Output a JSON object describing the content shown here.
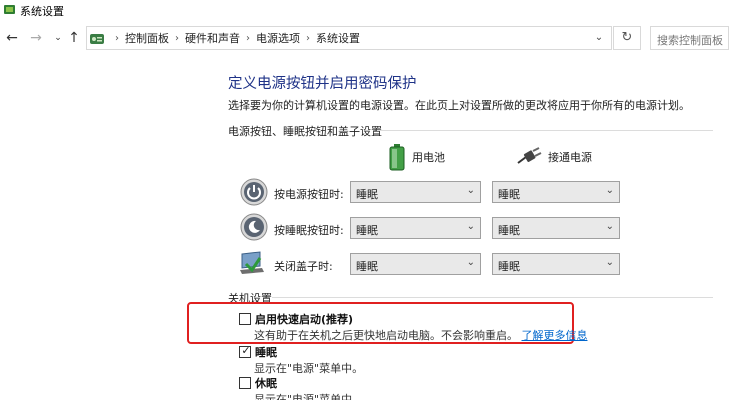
{
  "window": {
    "title": "系统设置"
  },
  "nav": {
    "breadcrumbs": [
      "控制面板",
      "硬件和声音",
      "电源选项",
      "系统设置"
    ],
    "search_placeholder": "搜索控制面板"
  },
  "page": {
    "heading": "定义电源按钮并启用密码保护",
    "subtitle": "选择要为你的计算机设置的电源设置。在此页上对设置所做的更改将应用于你所有的电源计划。"
  },
  "buttons_section": {
    "label": "电源按钮、睡眠按钮和盖子设置",
    "columns": [
      {
        "label": "用电池",
        "icon": "battery-icon"
      },
      {
        "label": "接通电源",
        "icon": "plug-icon"
      }
    ],
    "rows": [
      {
        "label": "按电源按钮时:",
        "icon": "power-button-icon",
        "battery": "睡眠",
        "plugged": "睡眠"
      },
      {
        "label": "按睡眠按钮时:",
        "icon": "sleep-button-icon",
        "battery": "睡眠",
        "plugged": "睡眠"
      },
      {
        "label": "关闭盖子时:",
        "icon": "laptop-lid-icon",
        "battery": "睡眠",
        "plugged": "睡眠"
      }
    ]
  },
  "shutdown_section": {
    "label": "关机设置",
    "options": [
      {
        "label": "启用快速启动(推荐)",
        "checked": false,
        "desc": "这有助于在关机之后更快地启动电脑。不会影响重启。",
        "link": "了解更多信息"
      },
      {
        "label": "睡眠",
        "checked": true,
        "desc": "显示在\"电源\"菜单中。"
      },
      {
        "label": "休眠",
        "checked": false,
        "desc": "显示在\"电源\"菜单中。"
      }
    ]
  },
  "colors": {
    "heading": "#1e3287",
    "highlight": "#e02020",
    "link": "#0066cc"
  }
}
